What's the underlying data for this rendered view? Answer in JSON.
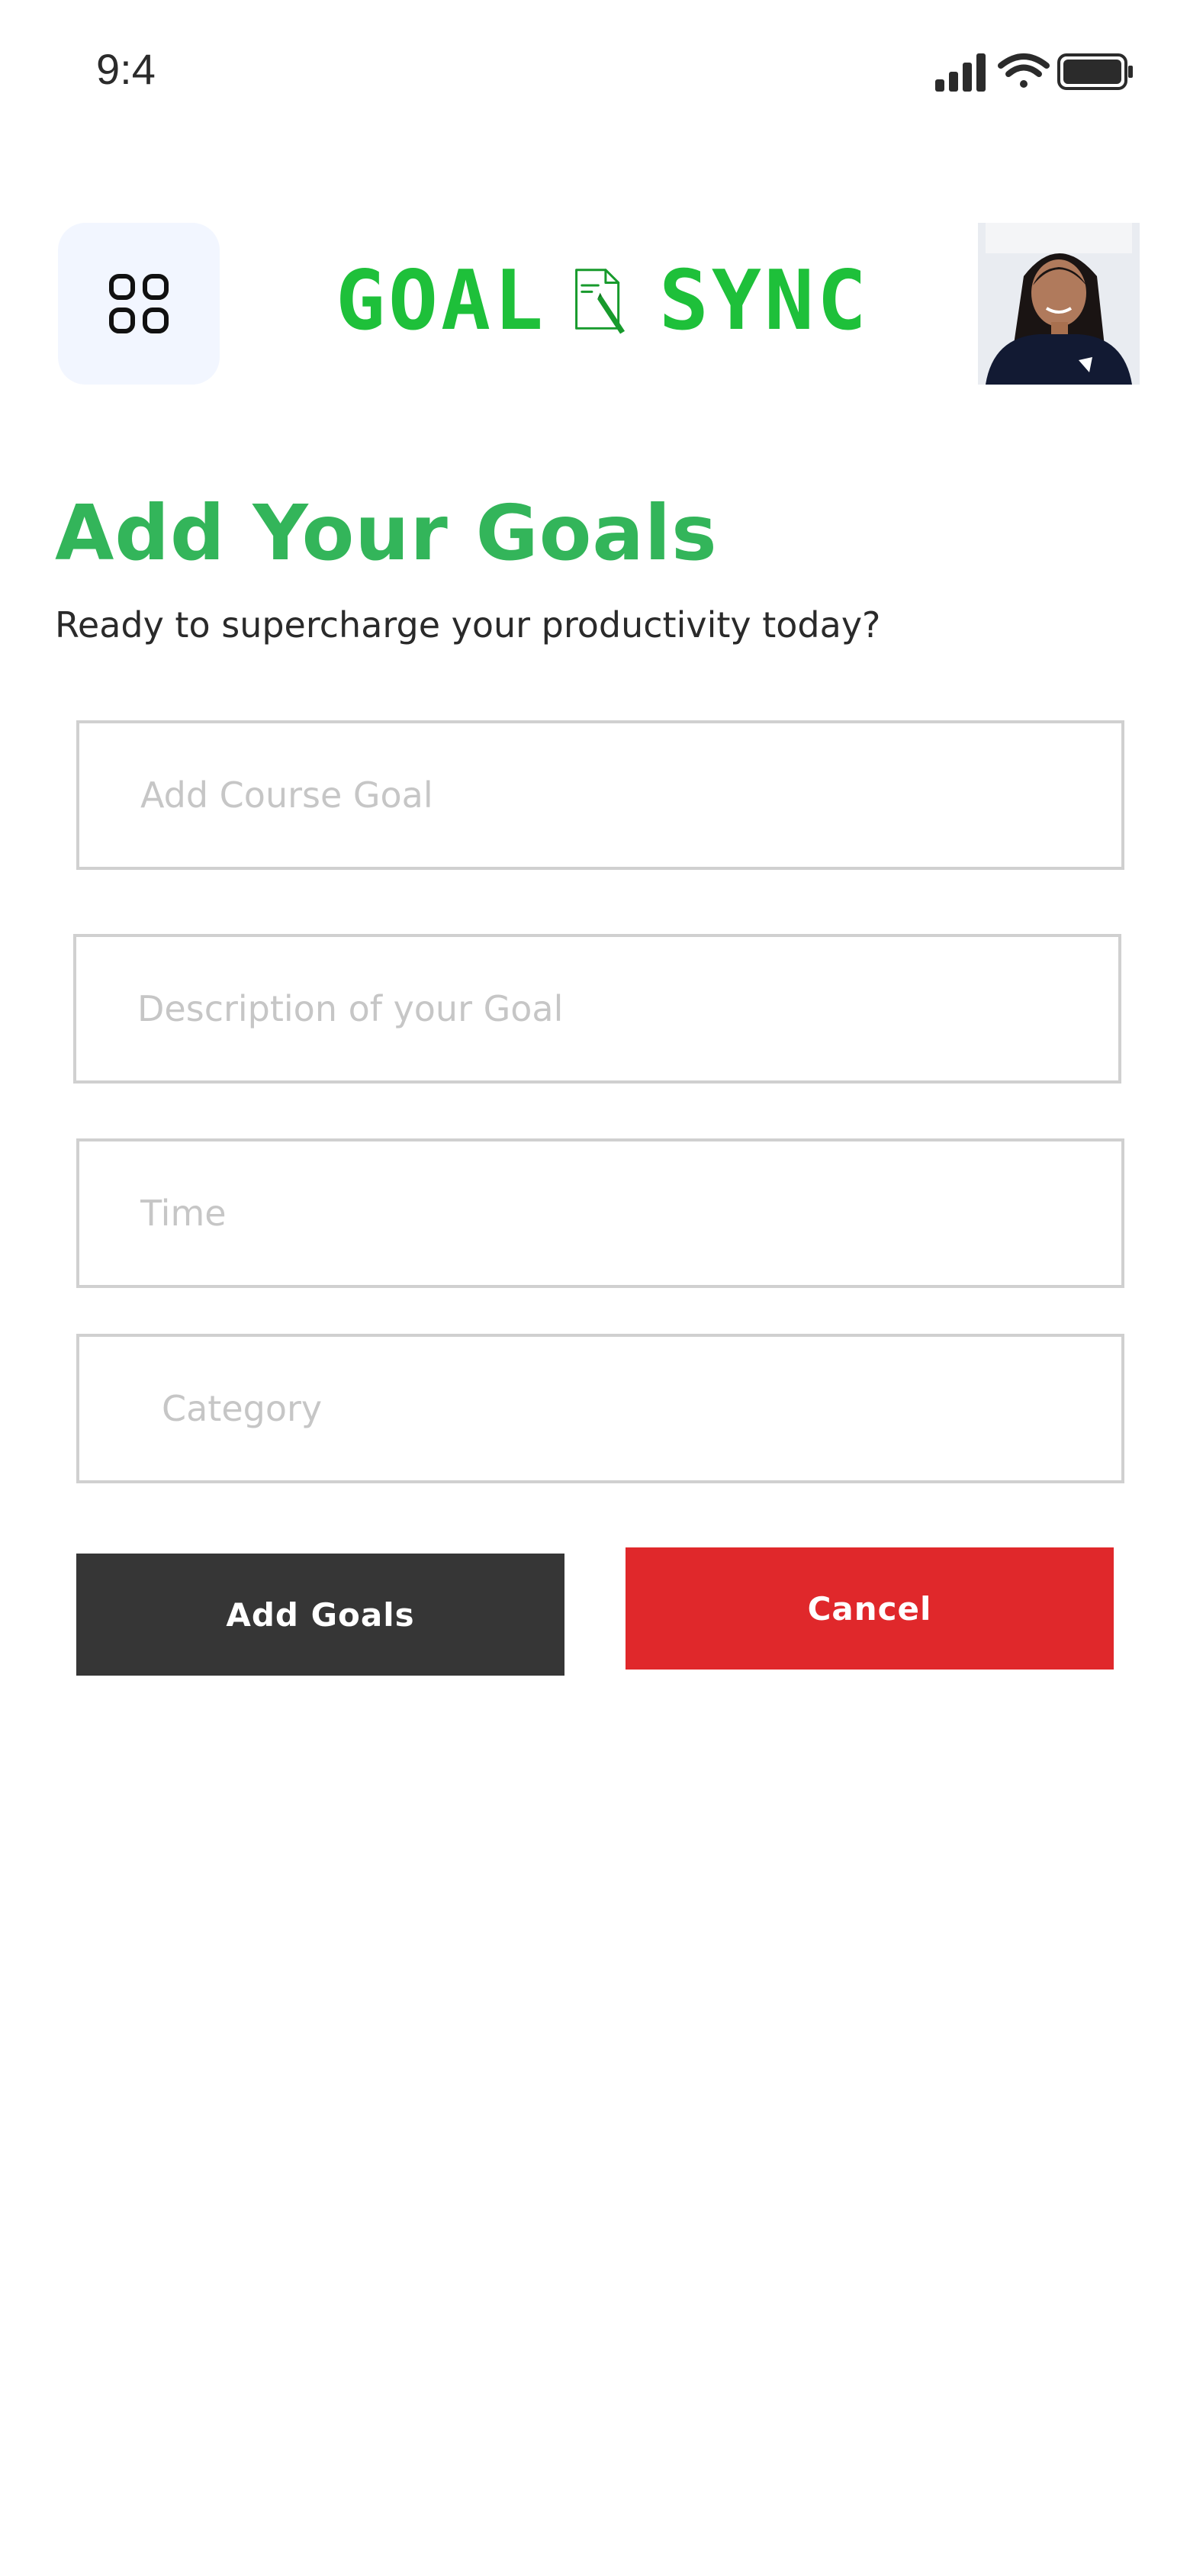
{
  "status_bar": {
    "time": "9:4",
    "icons": [
      "signal-icon",
      "wifi-icon",
      "battery-icon"
    ]
  },
  "header": {
    "menu_icon": "grid-menu-icon",
    "logo": {
      "word1": "GOAL",
      "word2": "SYNC",
      "icon": "document-pen-icon"
    },
    "avatar": "user-avatar"
  },
  "page": {
    "title": "Add Your Goals",
    "subtitle": "Ready to supercharge your productivity today?"
  },
  "form": {
    "course_goal": {
      "value": "",
      "placeholder": "Add Course Goal"
    },
    "description": {
      "value": "",
      "placeholder": "Description of your Goal"
    },
    "time": {
      "value": "",
      "placeholder": "Time"
    },
    "category": {
      "value": "",
      "placeholder": "Category"
    }
  },
  "actions": {
    "add_label": "Add Goals",
    "cancel_label": "Cancel"
  },
  "colors": {
    "accent_green": "#33b55a",
    "logo_green": "#1ec03a",
    "add_button": "#363636",
    "cancel_button": "#e0282b",
    "menu_bg": "#f2f6ff"
  }
}
